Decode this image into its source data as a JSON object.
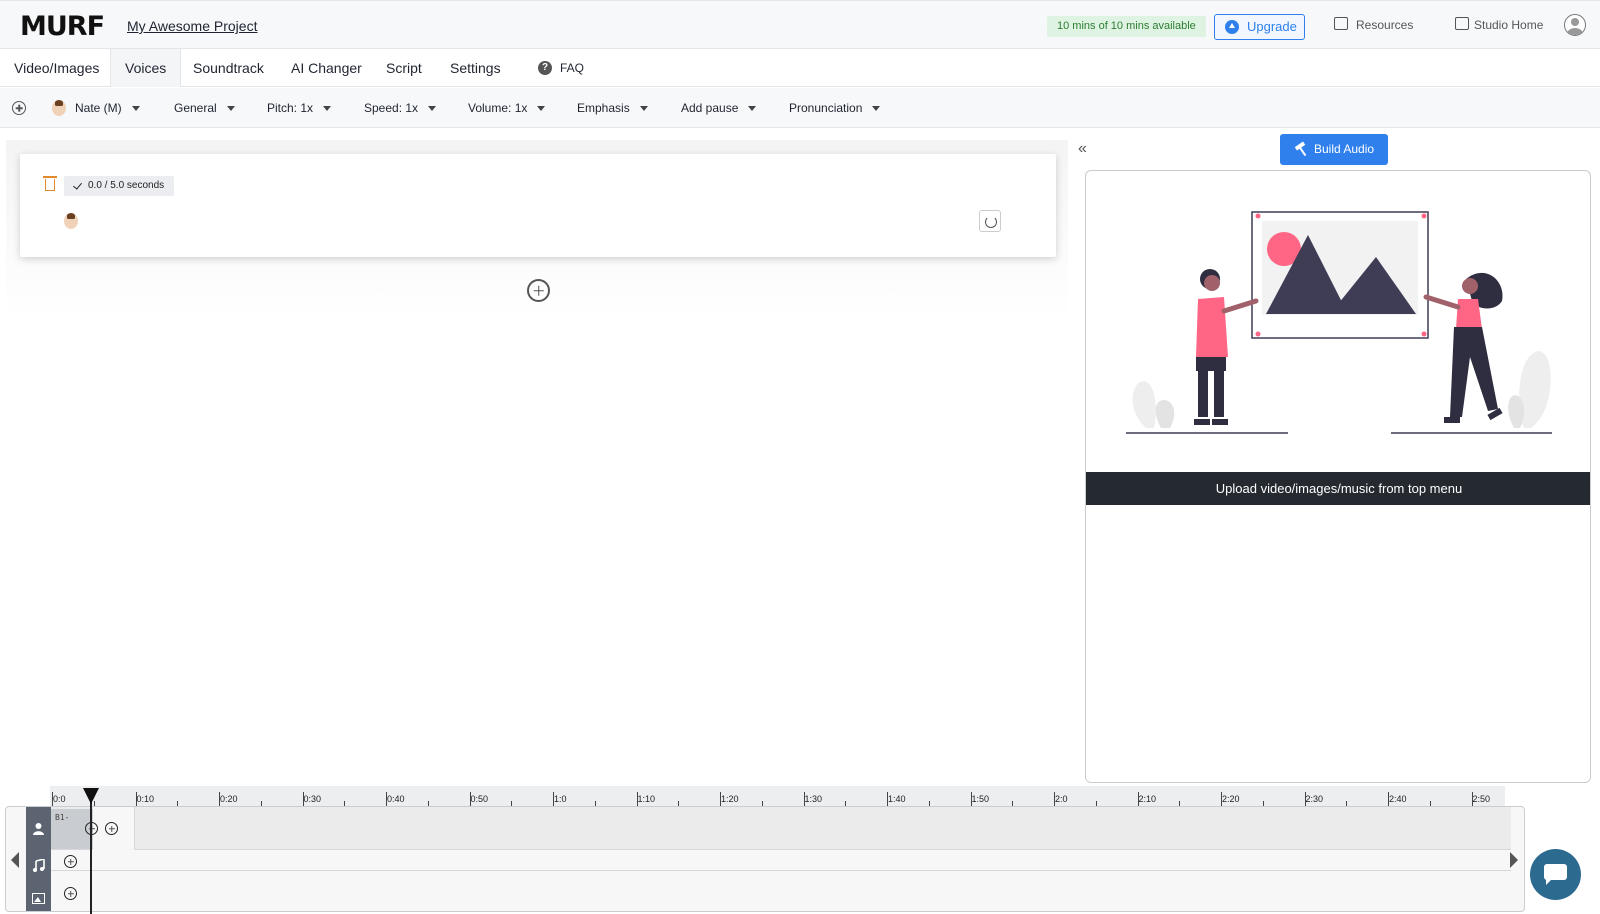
{
  "header": {
    "logo": "MURF",
    "project_title": "My Awesome Project",
    "mins_available": "10 mins of 10 mins available",
    "upgrade_label": "Upgrade",
    "resources_label": "Resources",
    "studio_home_label": "Studio Home"
  },
  "tabs": [
    {
      "label": "Video/Images"
    },
    {
      "label": "Voices"
    },
    {
      "label": "Soundtrack"
    },
    {
      "label": "AI Changer"
    },
    {
      "label": "Script"
    },
    {
      "label": "Settings"
    }
  ],
  "faq_label": "FAQ",
  "toolbar": {
    "voice": "Nate (M)",
    "style": "General",
    "pitch": "Pitch: 1x",
    "speed": "Speed: 1x",
    "volume": "Volume: 1x",
    "emphasis": "Emphasis",
    "add_pause": "Add pause",
    "pronunciation": "Pronunciation"
  },
  "block": {
    "duration": "0.0 / 5.0 seconds"
  },
  "build_audio_label": "Build Audio",
  "preview": {
    "banner": "Upload video/images/music from top menu"
  },
  "timeline": {
    "ticks": [
      "0:0",
      "0:10",
      "0:20",
      "0:30",
      "0:40",
      "0:50",
      "1:0",
      "1:10",
      "1:20",
      "1:30",
      "1:40",
      "1:50",
      "2:0",
      "2:10",
      "2:20",
      "2:30",
      "2:40",
      "2:50"
    ],
    "clip_label": "B1-"
  },
  "colors": {
    "accent": "#2f80ed",
    "banner": "#252a31",
    "mins_badge_bg": "#dff3e3",
    "mins_badge_text": "#2e7d32",
    "trash": "#e08a2c",
    "chat": "#2d6a8f"
  }
}
